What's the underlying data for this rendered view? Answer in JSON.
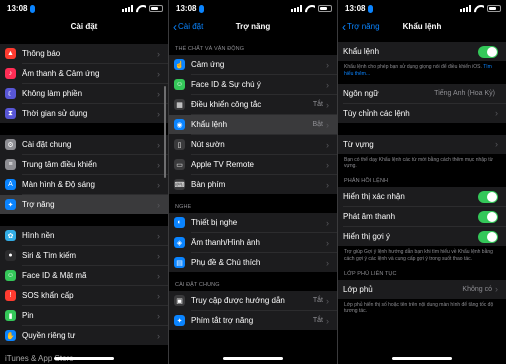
{
  "status": {
    "time": "13:08"
  },
  "colors": {
    "blue": "#0a84ff",
    "green": "#34c759"
  },
  "p1": {
    "title": "Cài đặt",
    "items": [
      {
        "label": "Thông báo",
        "color": "#ff3b30",
        "icon": "bell-icon"
      },
      {
        "label": "Âm thanh & Cảm ứng",
        "color": "#ff2d55",
        "icon": "speaker-icon"
      },
      {
        "label": "Không làm phiền",
        "color": "#5856d6",
        "icon": "moon-icon"
      },
      {
        "label": "Thời gian sử dụng",
        "color": "#5856d6",
        "icon": "hourglass-icon"
      },
      {
        "label": "Cài đặt chung",
        "color": "#8e8e93",
        "icon": "gear-icon"
      },
      {
        "label": "Trung tâm điều khiển",
        "color": "#8e8e93",
        "icon": "control-center-icon"
      },
      {
        "label": "Màn hình & Độ sáng",
        "color": "#0a84ff",
        "icon": "brightness-icon"
      },
      {
        "label": "Trợ năng",
        "color": "#0a84ff",
        "icon": "accessibility-icon"
      },
      {
        "label": "Hình nền",
        "color": "#32ade6",
        "icon": "wallpaper-icon"
      },
      {
        "label": "Siri & Tìm kiếm",
        "color": "#2c2c2e",
        "icon": "siri-icon"
      },
      {
        "label": "Face ID & Mật mã",
        "color": "#34c759",
        "icon": "face-id-icon"
      },
      {
        "label": "SOS khẩn cấp",
        "color": "#ff3b30",
        "icon": "sos-icon"
      },
      {
        "label": "Pin",
        "color": "#34c759",
        "icon": "battery-icon"
      },
      {
        "label": "Quyền riêng tư",
        "color": "#0a84ff",
        "icon": "hand-icon"
      }
    ],
    "bottom": "iTunes & App Store"
  },
  "p2": {
    "back": "Cài đặt",
    "title": "Trợ năng",
    "header1": "THỂ CHẤT VÀ VẬN ĐỘNG",
    "group1": [
      {
        "label": "Cảm ứng",
        "value": "",
        "color": "#0a84ff",
        "icon": "touch-icon"
      },
      {
        "label": "Face ID & Sự chú ý",
        "value": "",
        "color": "#34c759",
        "icon": "face-id-icon"
      },
      {
        "label": "Điều khiển công tắc",
        "value": "Tắt",
        "color": "#3a3a3c",
        "icon": "switch-control-icon"
      },
      {
        "label": "Khẩu lệnh",
        "value": "Bật",
        "color": "#0a84ff",
        "icon": "voice-control-icon"
      },
      {
        "label": "Nút sườn",
        "value": "",
        "color": "#3a3a3c",
        "icon": "side-button-icon"
      },
      {
        "label": "Apple TV Remote",
        "value": "",
        "color": "#3a3a3c",
        "icon": "remote-icon"
      },
      {
        "label": "Bàn phím",
        "value": "",
        "color": "#3a3a3c",
        "icon": "keyboard-icon"
      }
    ],
    "header2": "NGHE",
    "group2": [
      {
        "label": "Thiết bị nghe",
        "value": "",
        "color": "#0a84ff",
        "icon": "ear-icon"
      },
      {
        "label": "Âm thanh/Hình ảnh",
        "value": "",
        "color": "#0a84ff",
        "icon": "audio-visual-icon"
      },
      {
        "label": "Phụ đề & Chú thích",
        "value": "",
        "color": "#0a84ff",
        "icon": "subtitles-icon"
      }
    ],
    "header3": "CÀI ĐẶT CHUNG",
    "group3": [
      {
        "label": "Truy cập được hướng dẫn",
        "value": "Tắt",
        "color": "#3a3a3c",
        "icon": "lock-icon"
      },
      {
        "label": "Phím tắt trợ năng",
        "value": "Tắt",
        "color": "#0a84ff",
        "icon": "accessibility-icon"
      }
    ]
  },
  "p3": {
    "back": "Trợ năng",
    "title": "Khẩu lệnh",
    "toggle_label": "Khẩu lệnh",
    "toggle_footer": "Khẩu lệnh cho phép bạn sử dụng giọng nói để điều khiển iOS.",
    "toggle_footer_link": "Tìm hiểu thêm...",
    "language_label": "Ngôn ngữ",
    "language_value": "Tiếng Anh (Hoa Kỳ)",
    "customize_label": "Tùy chỉnh các lệnh",
    "vocab_label": "Từ vựng",
    "vocab_footer": "Bạn có thể dạy Khẩu lệnh các từ mới bằng cách thêm mục nhập từ vựng.",
    "feedback_header": "PHẢN HỒI LỆNH",
    "feedback": [
      {
        "label": "Hiển thị xác nhận"
      },
      {
        "label": "Phát âm thanh"
      },
      {
        "label": "Hiển thị gợi ý"
      }
    ],
    "feedback_footer": "Trợ giúp Gợi ý lệnh hướng dẫn bạn khi tìm hiểu về Khẩu lệnh bằng cách gợi ý các lệnh và cung cấp gợi ý trong suốt thao tác.",
    "overlay_header": "LỚP PHỦ LIÊN TỤC",
    "overlay_label": "Lớp phủ",
    "overlay_value": "Không có",
    "overlay_footer": "Lớp phủ hiển thị số hoặc tên trên nội dung màn hình để tăng tốc độ tương tác."
  }
}
